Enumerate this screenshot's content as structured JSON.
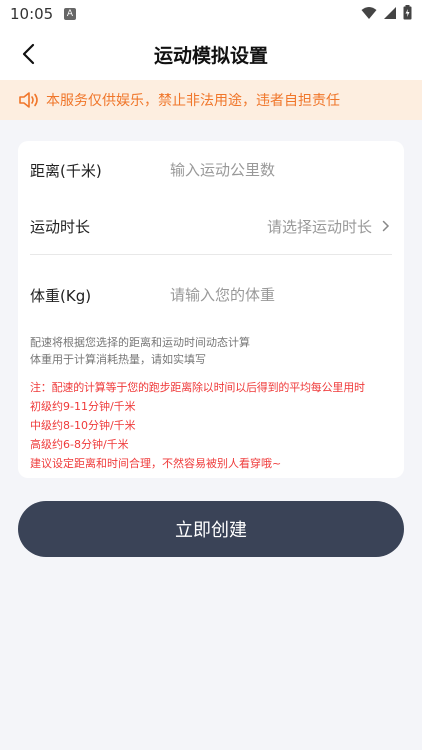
{
  "status_bar": {
    "time": "10:05",
    "notification_badge": "A"
  },
  "header": {
    "title": "运动模拟设置"
  },
  "notice": {
    "text": "本服务仅供娱乐，禁止非法用途，违者自担责任",
    "color": "#f0762a"
  },
  "form": {
    "distance": {
      "label": "距离(千米)",
      "placeholder": "输入运动公里数"
    },
    "duration": {
      "label": "运动时长",
      "placeholder": "请选择运动时长"
    },
    "weight": {
      "label": "体重(Kg)",
      "placeholder": "请输入您的体重"
    }
  },
  "hints": [
    "配速将根据您选择的距离和运动时间动态计算",
    "体重用于计算消耗热量，请如实填写"
  ],
  "warnings": [
    "注：配速的计算等于您的跑步距离除以时间以后得到的平均每公里用时",
    "初级约9-11分钟/千米",
    "中级约8-10分钟/千米",
    "高级约6-8分钟/千米",
    "建议设定距离和时间合理，不然容易被别人看穿哦~"
  ],
  "actions": {
    "create_label": "立即创建"
  },
  "colors": {
    "accent": "#3a4357",
    "warning": "#ef3b3b",
    "notice_bg": "#fdeee0"
  }
}
